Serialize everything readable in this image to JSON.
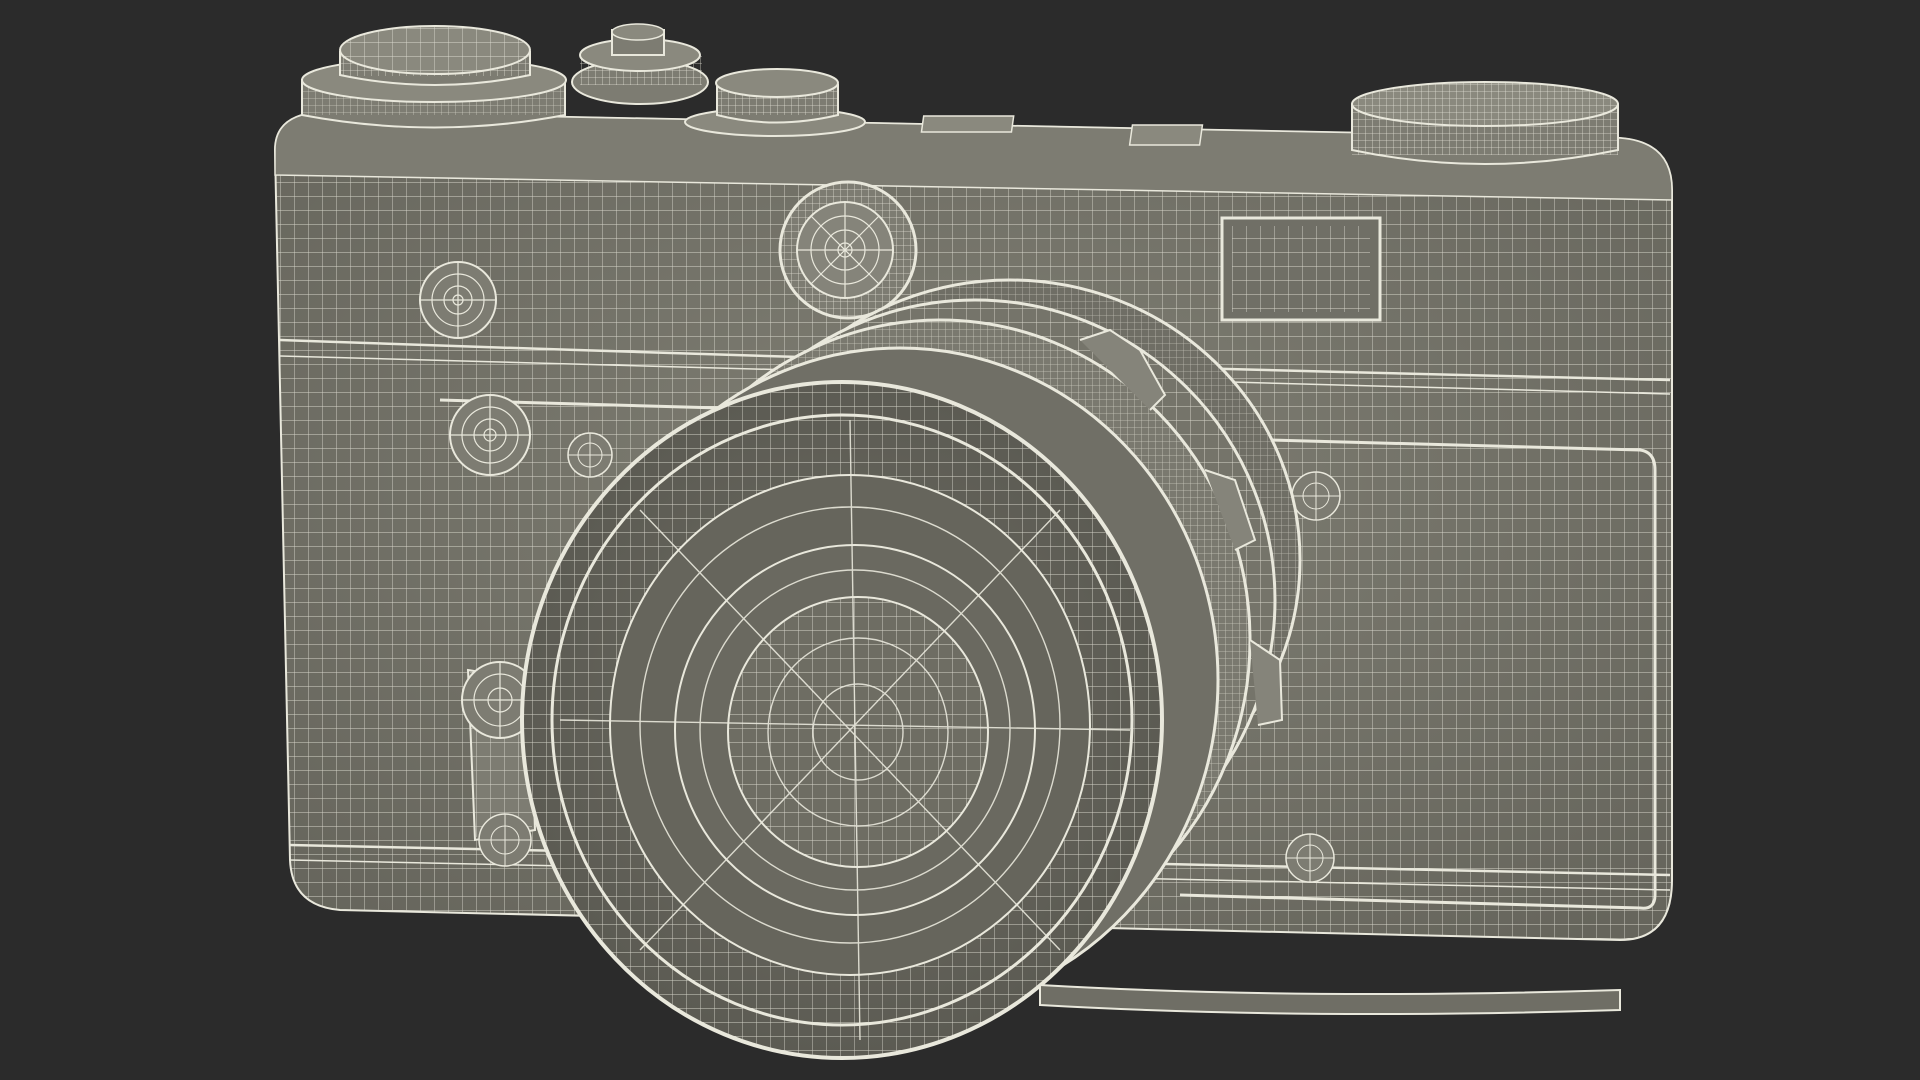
{
  "scene": {
    "background_color": "#2b2b2b",
    "model_fill_color": "#77766c",
    "model_fill_dark": "#5f5e56",
    "model_fill_light": "#8a897e",
    "wire_color": "#e9e8dc",
    "subject": "camera-wireframe-model"
  }
}
